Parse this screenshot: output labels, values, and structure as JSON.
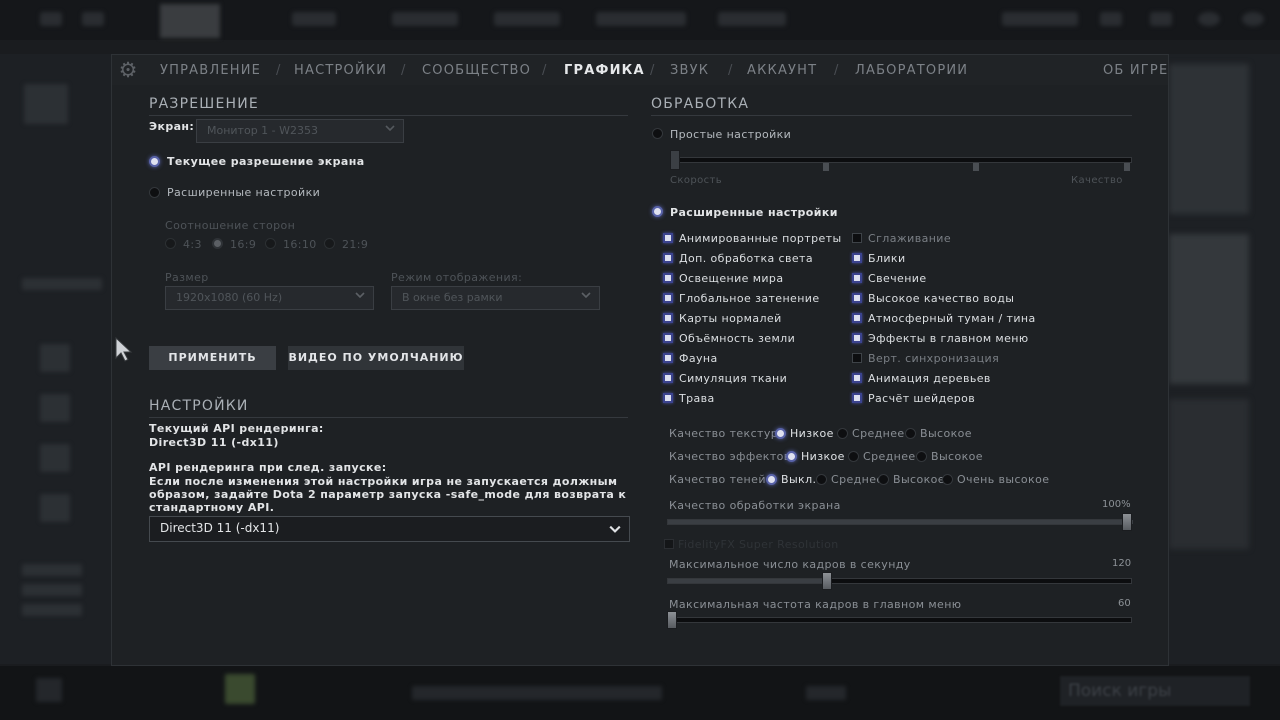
{
  "tabs": [
    "УПРАВЛЕНИЕ",
    "НАСТРОЙКИ",
    "СООБЩЕСТВО",
    "ГРАФИКА",
    "ЗВУК",
    "АККАУНТ",
    "ЛАБОРАТОРИИ"
  ],
  "about_tab": "ОБ ИГРЕ",
  "resolution": {
    "title": "РАЗРЕШЕНИЕ",
    "screen_label": "Экран:",
    "screen_value": "Монитор 1 - W2353",
    "current_res_label": "Текущее разрешение экрана",
    "advanced_label": "Расширенные настройки",
    "aspect_label": "Соотношение сторон",
    "aspects": [
      "4:3",
      "16:9",
      "16:10",
      "21:9"
    ],
    "size_label": "Размер",
    "size_value": "1920x1080 (60 Hz)",
    "display_mode_label": "Режим отображения:",
    "display_mode_value": "В окне без рамки",
    "apply_button": "ПРИМЕНИТЬ",
    "default_button": "ВИДЕО ПО УМОЛЧАНИЮ"
  },
  "settings": {
    "title": "НАСТРОЙКИ",
    "current_api_label": "Текущий API рендеринга:",
    "current_api_value": "Direct3D 11 (-dx11)",
    "next_api_label": "API рендеринга при след. запуске:",
    "warning_line1": "Если после изменения этой настройки игра не запускается должным",
    "warning_line2": "образом, задайте Dota 2 параметр запуска -safe_mode для возврата к",
    "warning_line3": "стандартному API.",
    "api_dropdown_value": "Direct3D 11 (-dx11)"
  },
  "processing": {
    "title": "ОБРАБОТКА",
    "simple_label": "Простые настройки",
    "speed_label": "Скорость",
    "quality_label": "Качество",
    "advanced_label": "Расширенные настройки",
    "checks_left": [
      {
        "label": "Анимированные портреты",
        "checked": true
      },
      {
        "label": "Доп. обработка света",
        "checked": true
      },
      {
        "label": "Освещение мира",
        "checked": true
      },
      {
        "label": "Глобальное затенение",
        "checked": true
      },
      {
        "label": "Карты нормалей",
        "checked": true
      },
      {
        "label": "Объёмность земли",
        "checked": true
      },
      {
        "label": "Фауна",
        "checked": true
      },
      {
        "label": "Симуляция ткани",
        "checked": true
      },
      {
        "label": "Трава",
        "checked": true
      }
    ],
    "checks_right": [
      {
        "label": "Сглаживание",
        "checked": false
      },
      {
        "label": "Блики",
        "checked": true
      },
      {
        "label": "Свечение",
        "checked": true
      },
      {
        "label": "Высокое качество воды",
        "checked": true
      },
      {
        "label": "Атмосферный туман / тина",
        "checked": true
      },
      {
        "label": "Эффекты в главном меню",
        "checked": true
      },
      {
        "label": "Верт. синхронизация",
        "checked": false
      },
      {
        "label": "Анимация деревьев",
        "checked": true
      },
      {
        "label": "Расчёт шейдеров",
        "checked": true
      }
    ],
    "texture_quality": {
      "label": "Качество текстур",
      "options": [
        "Низкое",
        "Среднее",
        "Высокое"
      ],
      "selected": "Низкое"
    },
    "effects_quality": {
      "label": "Качество эффектов",
      "options": [
        "Низкое",
        "Среднее",
        "Высокое"
      ],
      "selected": "Низкое"
    },
    "shadow_quality": {
      "label": "Качество теней",
      "options": [
        "Выкл.",
        "Среднее",
        "Высокое",
        "Очень высокое"
      ],
      "selected": "Выкл."
    },
    "screen_quality": {
      "label": "Качество обработки экрана",
      "value_text": "100%",
      "fraction": 1.0
    },
    "fidelityfx_label": "FidelityFX Super Resolution",
    "max_fps": {
      "label": "Максимальное число кадров в секунду",
      "value_text": "120",
      "fraction": 0.34
    },
    "max_menu_fps": {
      "label": "Максимальная частота кадров в главном меню",
      "value_text": "60",
      "fraction": 0.0
    }
  },
  "background": {
    "search_placeholder": "Поиск игры"
  }
}
